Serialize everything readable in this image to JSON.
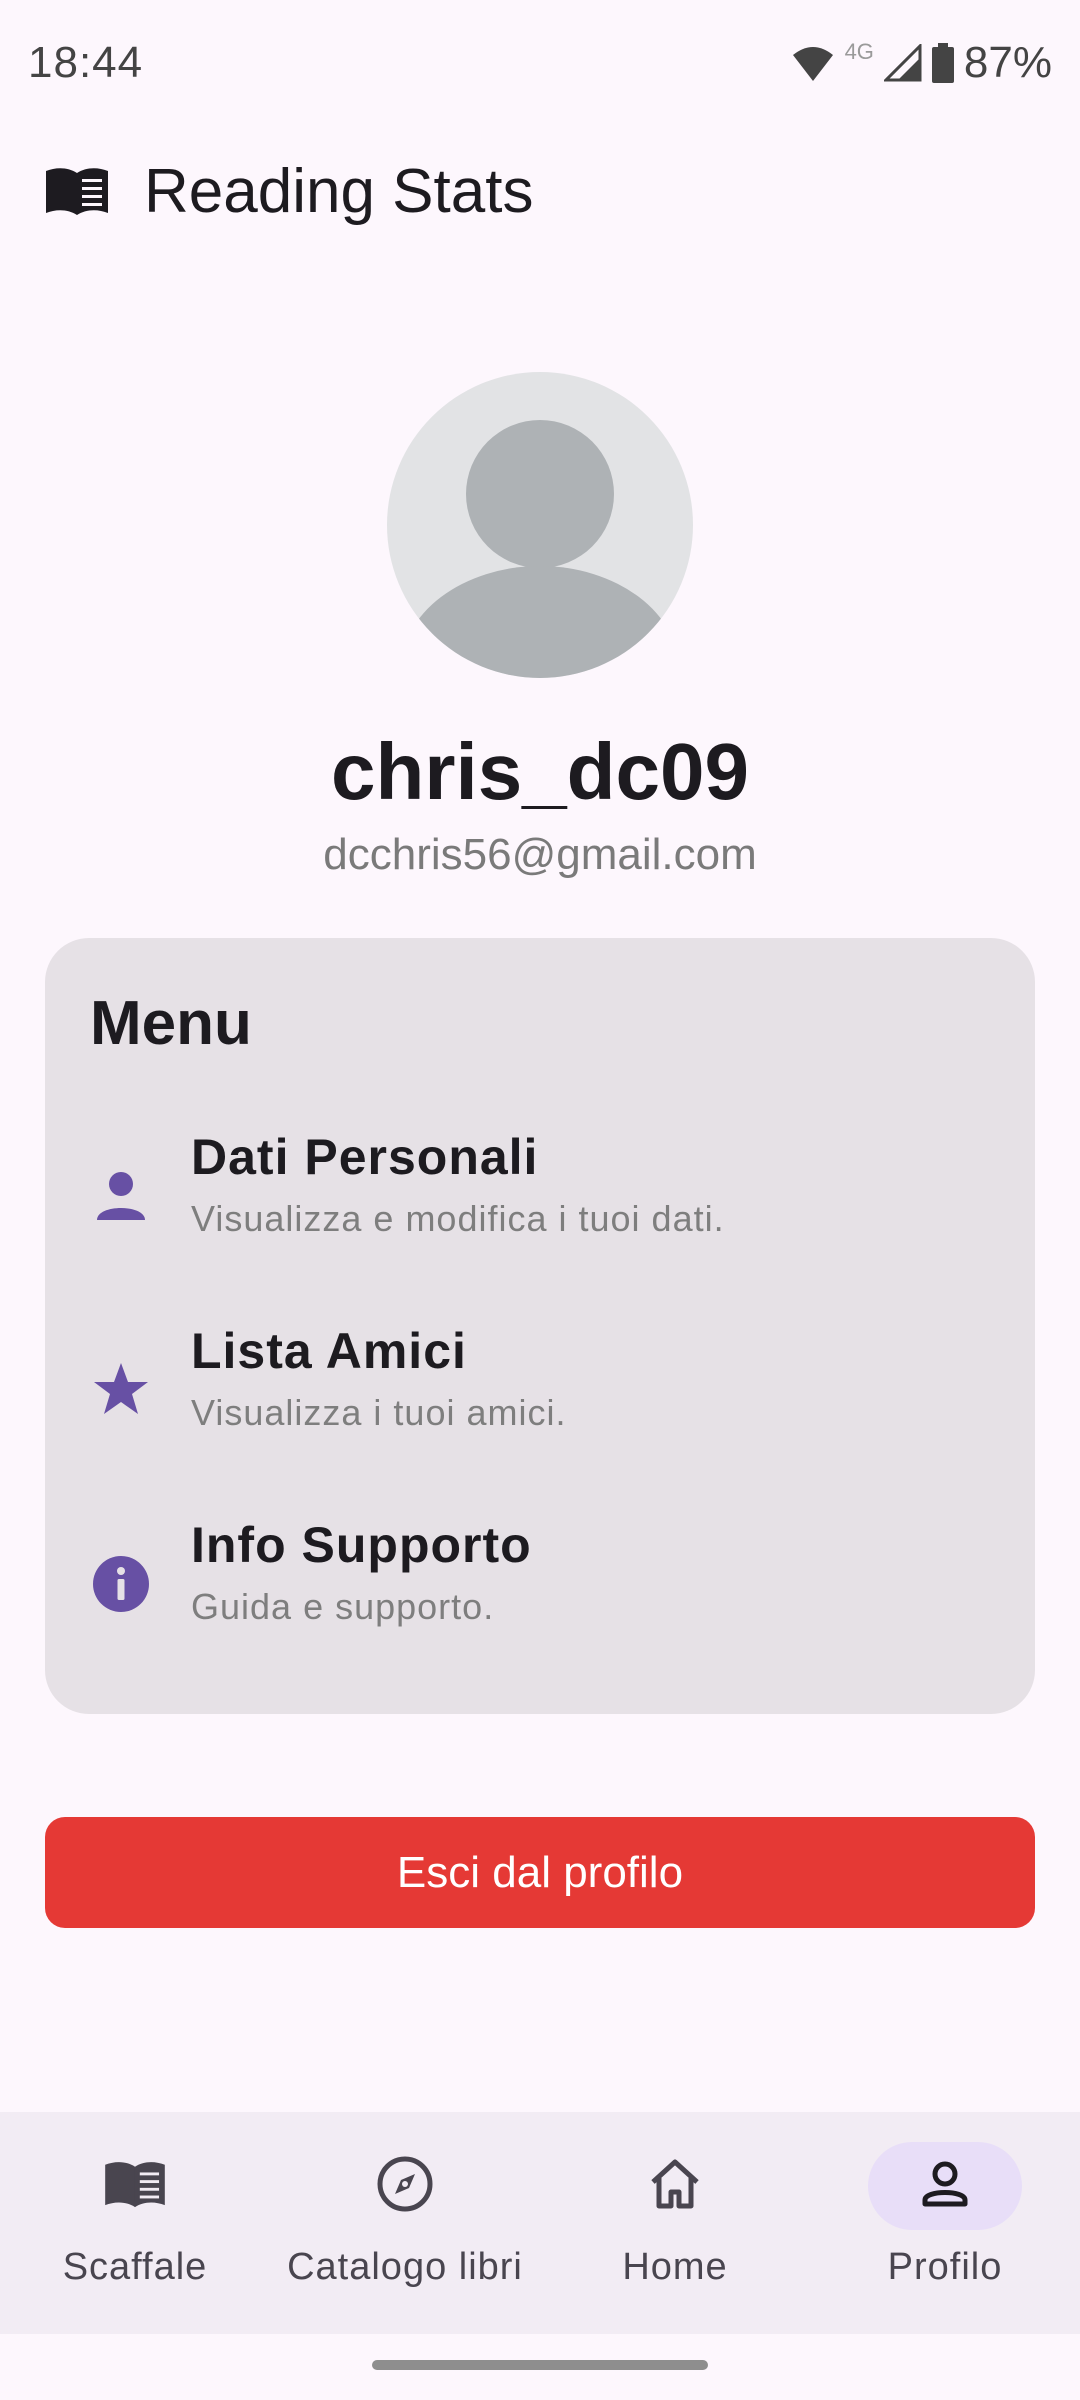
{
  "status_bar": {
    "time": "18:44",
    "network": "4G",
    "battery": "87%"
  },
  "app_bar": {
    "title": "Reading Stats",
    "icon": "book-icon"
  },
  "profile": {
    "username": "chris_dc09",
    "email": "dcchris56@gmail.com"
  },
  "menu": {
    "title": "Menu",
    "items": [
      {
        "icon": "person-icon",
        "title": "Dati Personali",
        "subtitle": "Visualizza e modifica i tuoi dati."
      },
      {
        "icon": "star-icon",
        "title": "Lista Amici",
        "subtitle": "Visualizza i tuoi amici."
      },
      {
        "icon": "info-icon",
        "title": "Info Supporto",
        "subtitle": "Guida e supporto."
      }
    ]
  },
  "logout_label": "Esci dal profilo",
  "bottom_nav": [
    {
      "icon": "book-icon",
      "label": "Scaffale",
      "active": false
    },
    {
      "icon": "compass-icon",
      "label": "Catalogo libri",
      "active": false
    },
    {
      "icon": "home-icon",
      "label": "Home",
      "active": false
    },
    {
      "icon": "person-outline-icon",
      "label": "Profilo",
      "active": true
    }
  ],
  "colors": {
    "background": "#FDF7FD",
    "accent": "#6750A4",
    "danger": "#E53935",
    "card": "#E6E1E6",
    "nav_bg": "#F2ECF4",
    "nav_active": "#E8DEF8"
  }
}
